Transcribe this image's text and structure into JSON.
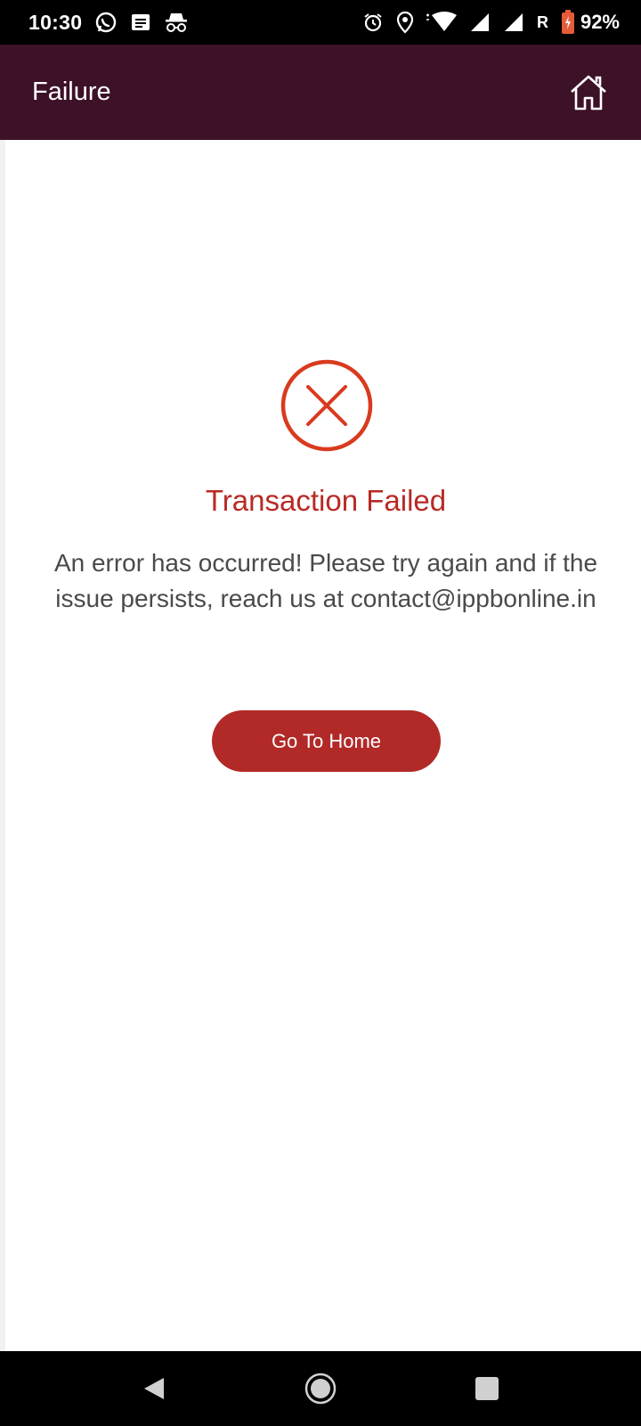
{
  "status_bar": {
    "time": "10:30",
    "icons_left": [
      "whatsapp-icon",
      "message-icon",
      "incognito-icon"
    ],
    "icons_right": [
      "alarm-icon",
      "location-icon",
      "wifi-icon",
      "signal-icon",
      "signal-icon"
    ],
    "roaming": "R",
    "battery": "92%"
  },
  "app_bar": {
    "title": "Failure",
    "home_icon": "home-icon",
    "background": "#3d1128"
  },
  "result": {
    "icon": "error-circle-icon",
    "title": "Transaction Failed",
    "message": "An error has occurred! Please try again and if the issue persists, reach us at contact@ippbonline.in",
    "button_label": "Go To Home",
    "accent": "#b82a25"
  },
  "nav_bar": {
    "back": "back-icon",
    "home": "home-circle-icon",
    "recents": "recents-icon"
  }
}
